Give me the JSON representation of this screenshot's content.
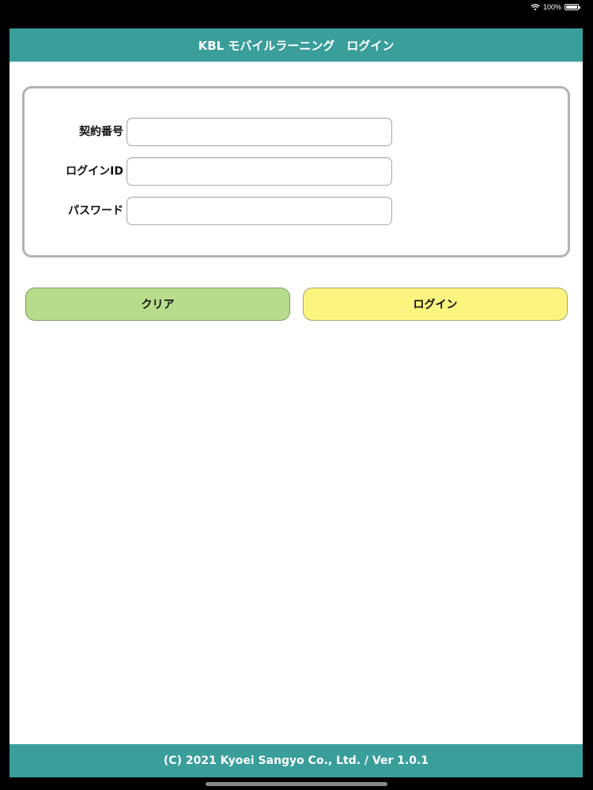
{
  "status_bar": {
    "battery_text": "100%",
    "icons": [
      "wifi-icon",
      "battery-icon"
    ]
  },
  "header": {
    "title": "KBL モバイルラーニング　ログイン"
  },
  "form": {
    "contract_number": {
      "label": "契約番号",
      "value": "",
      "placeholder": ""
    },
    "login_id": {
      "label": "ログインID",
      "value": "",
      "placeholder": ""
    },
    "password": {
      "label": "パスワード",
      "value": "",
      "placeholder": ""
    }
  },
  "buttons": {
    "clear_label": "クリア",
    "login_label": "ログイン"
  },
  "footer": {
    "text": "(C) 2021 Kyoei Sangyo Co., Ltd. / Ver 1.0.1"
  },
  "colors": {
    "header_bg": "#3a9e9b",
    "clear_button_bg": "#b7dc8c",
    "login_button_bg": "#fbf57f",
    "panel_border": "#b3b3b3"
  }
}
